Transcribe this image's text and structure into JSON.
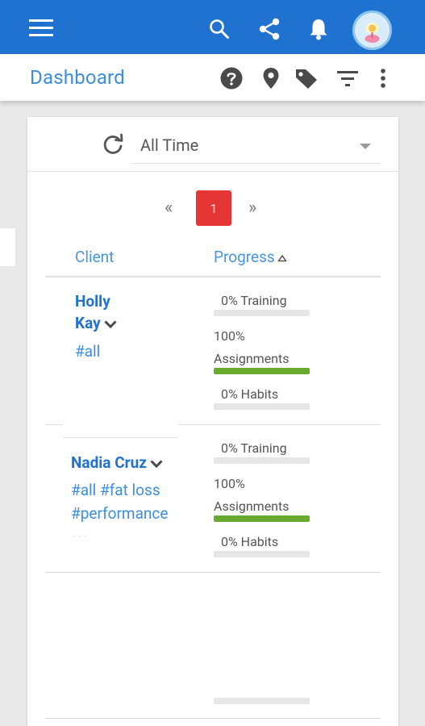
{
  "topbar": {
    "menu_icon": "menu-icon",
    "search_icon": "search-icon",
    "share_icon": "share-icon",
    "bell_icon": "bell-icon",
    "avatar": "avatar"
  },
  "subbar": {
    "title": "Dashboard",
    "icons": [
      "help-icon",
      "location-pin-icon",
      "tag-icon",
      "filter-icon",
      "more-vert-icon"
    ]
  },
  "filter": {
    "refresh_icon": "refresh-icon",
    "range": "All Time"
  },
  "pagination": {
    "prev": "«",
    "current": "1",
    "next": "»"
  },
  "table": {
    "columns": [
      "Client",
      "Progress"
    ],
    "sort_icon": "sort-up-icon",
    "rows": [
      {
        "name_line1": "Holly",
        "name_line2": "Kay",
        "tags": "#all",
        "training": {
          "label": "0% Training",
          "value": 0
        },
        "assignments": {
          "percent": "100%",
          "label": "Assignments",
          "value": 1
        },
        "habits": {
          "label": "0% Habits",
          "value": 0
        }
      },
      {
        "name": "Nadia Cruz",
        "tags_line1": "#all #fat loss",
        "tags_line2": "#performance",
        "training": {
          "label": "0% Training",
          "value": 0
        },
        "assignments": {
          "percent": "100%",
          "label": "Assignments",
          "value": 1
        },
        "habits": {
          "label": "0% Habits",
          "value": 0
        }
      }
    ]
  },
  "colors": {
    "appbar": "#1f72cf",
    "accent": "#3d8ede",
    "progress_fill": "#6aaa2e",
    "page_active": "#e53535"
  }
}
